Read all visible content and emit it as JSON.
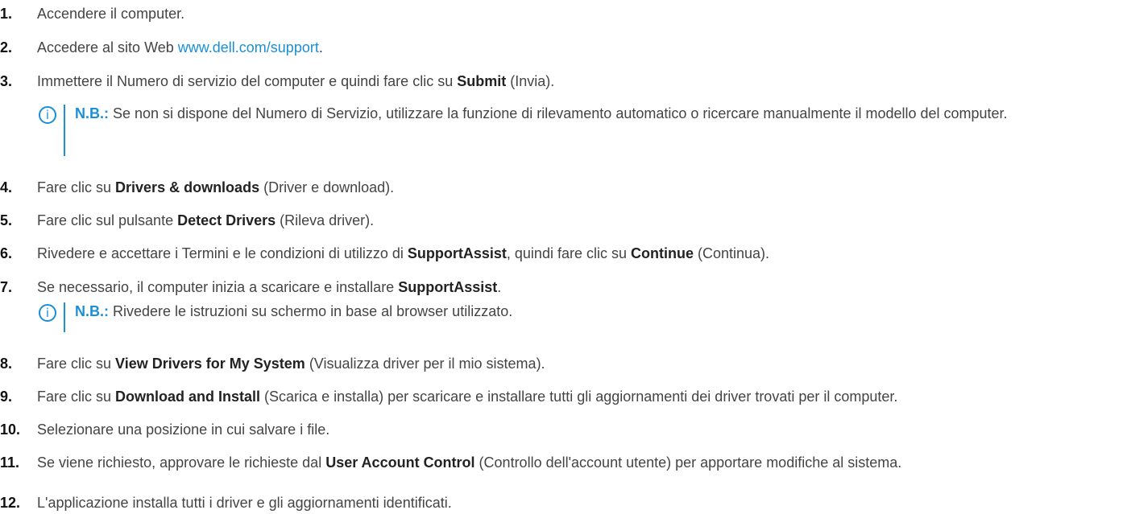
{
  "steps": [
    {
      "num": "1.",
      "text": "Accendere il computer."
    },
    {
      "num": "2.",
      "pre": "Accedere al sito Web ",
      "link": "www.dell.com/support",
      "post": "."
    },
    {
      "num": "3.",
      "pre": "Immettere il Numero di servizio del computer e quindi fare clic su ",
      "bold": "Submit",
      "post": " (Invia)."
    },
    {
      "num": "4.",
      "pre": "Fare clic su ",
      "bold": "Drivers & downloads",
      "post": " (Driver e download)."
    },
    {
      "num": "5.",
      "pre": "Fare clic sul pulsante ",
      "bold": "Detect Drivers",
      "post": " (Rileva driver)."
    },
    {
      "num": "6.",
      "pre": "Rivedere e accettare i Termini e le condizioni di utilizzo di ",
      "bold": "SupportAssist",
      "mid": ", quindi fare clic su ",
      "bold2": "Continue",
      "post": " (Continua)."
    },
    {
      "num": "7.",
      "pre": "Se necessario, il computer inizia a scaricare e installare ",
      "bold": "SupportAssist",
      "post": "."
    },
    {
      "num": "8.",
      "pre": "Fare clic su ",
      "bold": "View Drivers for My System",
      "post": " (Visualizza driver per il mio sistema)."
    },
    {
      "num": "9.",
      "pre": "Fare clic su ",
      "bold": "Download and Install",
      "post": " (Scarica e installa) per scaricare e installare tutti gli aggiornamenti dei driver trovati per il computer."
    },
    {
      "num": "10.",
      "text": "Selezionare una posizione in cui salvare i file."
    },
    {
      "num": "11.",
      "pre": "Se viene richiesto, approvare le richieste dal ",
      "bold": "User Account Control",
      "post": " (Controllo dell'account utente) per apportare modifiche al sistema."
    },
    {
      "num": "12.",
      "text": "L'applicazione installa tutti i driver e gli aggiornamenti identificati."
    }
  ],
  "notes": [
    {
      "label": "N.B.:",
      "text": " Se non si dispone del Numero di Servizio, utilizzare la funzione di rilevamento automatico o ricercare manualmente il modello del computer."
    },
    {
      "label": "N.B.:",
      "text": " Rivedere le istruzioni su schermo in base al browser utilizzato."
    }
  ],
  "icons": {
    "note": "info-circle-icon",
    "note_glyph": "i"
  },
  "colors": {
    "accent": "#1a8fd6",
    "text": "#444444"
  }
}
